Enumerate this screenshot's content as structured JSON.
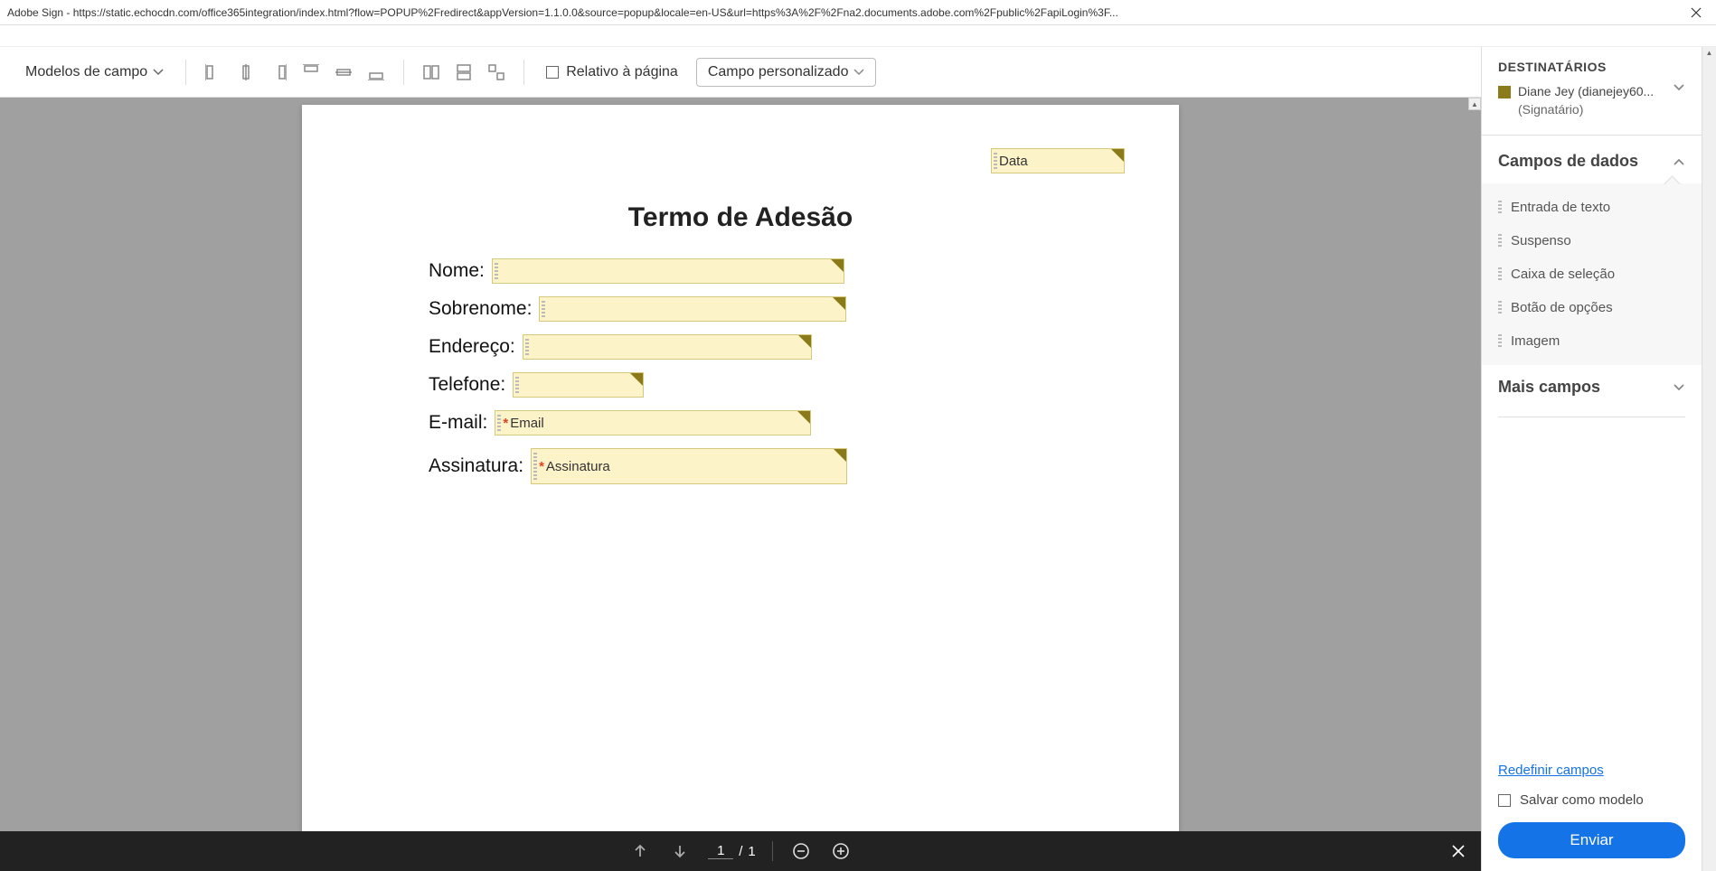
{
  "titlebar": {
    "text": "Adobe Sign - https://static.echocdn.com/office365integration/index.html?flow=POPUP%2Fredirect&appVersion=1.1.0.0&source=popup&locale=en-US&url=https%3A%2F%2Fna2.documents.adobe.com%2Fpublic%2FapiLogin%3F..."
  },
  "toolbar": {
    "templates_label": "Modelos de campo",
    "relative_label": "Relativo à página",
    "custom_field_label": "Campo personalizado"
  },
  "document": {
    "date_field_label": "Data",
    "title": "Termo de Adesão",
    "rows": {
      "nome": "Nome:",
      "sobrenome": "Sobrenome:",
      "endereco": "Endereço:",
      "telefone": "Telefone:",
      "email_label": "E-mail:",
      "email_field": "Email",
      "assinatura_label": "Assinatura:",
      "assinatura_field": "Assinatura"
    }
  },
  "pager": {
    "current": "1",
    "total": "1"
  },
  "sidebar": {
    "recipients_heading": "DESTINATÁRIOS",
    "recipient_name": "Diane Jey (dianejey60...",
    "recipient_role": "(Signatário)",
    "data_fields_heading": "Campos de dados",
    "field_items": {
      "text": "Entrada de texto",
      "dropdown": "Suspenso",
      "checkbox": "Caixa de seleção",
      "radio": "Botão de opções",
      "image": "Imagem"
    },
    "more_fields_heading": "Mais campos",
    "reset_link": "Redefinir campos",
    "save_template_label": "Salvar como modelo",
    "send_button": "Enviar"
  }
}
